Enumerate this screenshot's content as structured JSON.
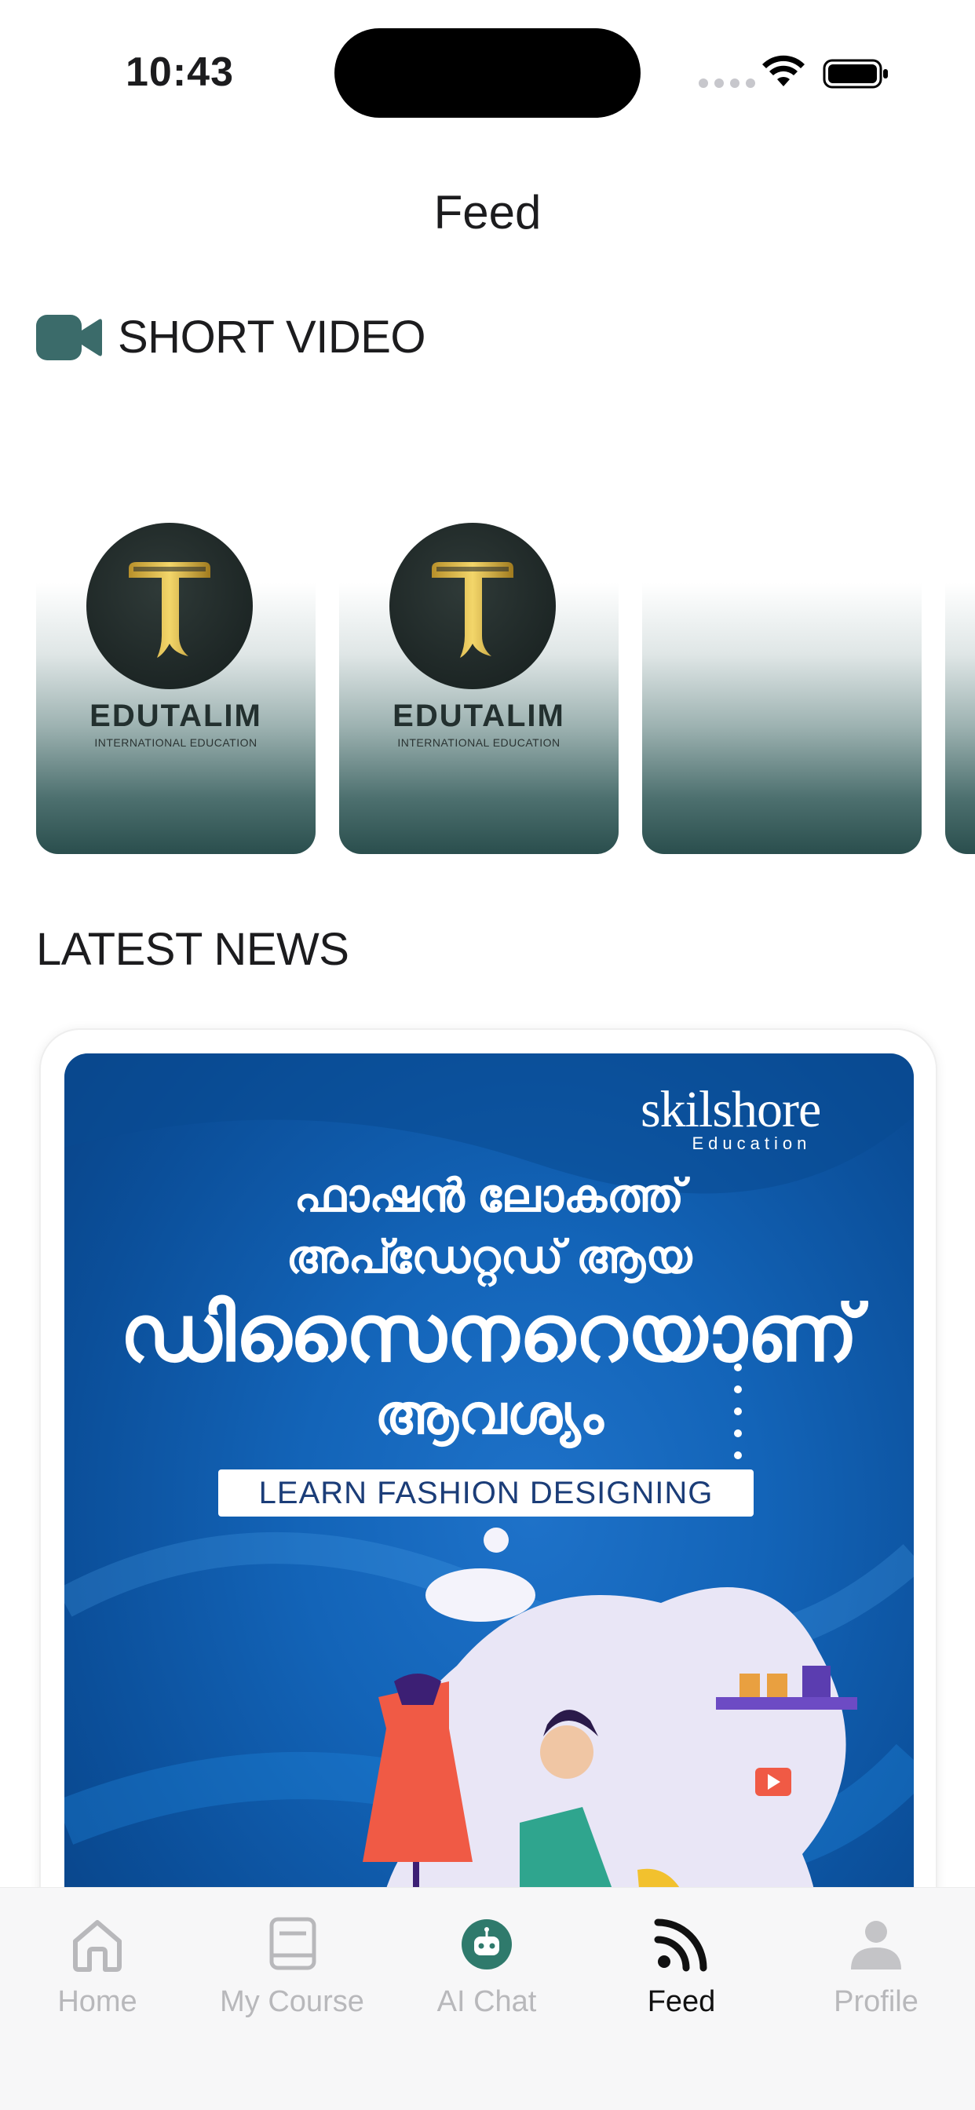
{
  "status_bar": {
    "time": "10:43"
  },
  "header": {
    "title": "Feed"
  },
  "short_video": {
    "title": "SHORT VIDEO",
    "cards": [
      {
        "brand": "EDUTALIM",
        "subtitle": "INTERNATIONAL EDUCATION"
      },
      {
        "brand": "EDUTALIM",
        "subtitle": "INTERNATIONAL EDUCATION"
      },
      {
        "brand": "",
        "subtitle": ""
      }
    ]
  },
  "latest_news": {
    "title": "LATEST NEWS",
    "post": {
      "brand_name": "skilshore",
      "brand_tag": "Education",
      "headline_line1": "ഫാഷൻ ലോകത്ത്",
      "headline_line2": "അപ്ഡേറ്റഡ് ആയ",
      "headline_line3": "ഡിസൈനറെയാണ്",
      "headline_line4": "ആവശ്യം",
      "banner": "LEARN FASHION DESIGNING"
    }
  },
  "tab_bar": {
    "tabs": [
      {
        "label": "Home",
        "icon": "home-icon",
        "active": false
      },
      {
        "label": "My Course",
        "icon": "book-icon",
        "active": false
      },
      {
        "label": "AI Chat",
        "icon": "robot-icon",
        "active": false
      },
      {
        "label": "Feed",
        "icon": "rss-icon",
        "active": true
      },
      {
        "label": "Profile",
        "icon": "person-icon",
        "active": false
      }
    ]
  },
  "colors": {
    "accent_teal": "#2f5f5e",
    "active_tab": "#111111",
    "inactive_tab": "#b8b8bb",
    "news_blue": "#1364b8"
  }
}
